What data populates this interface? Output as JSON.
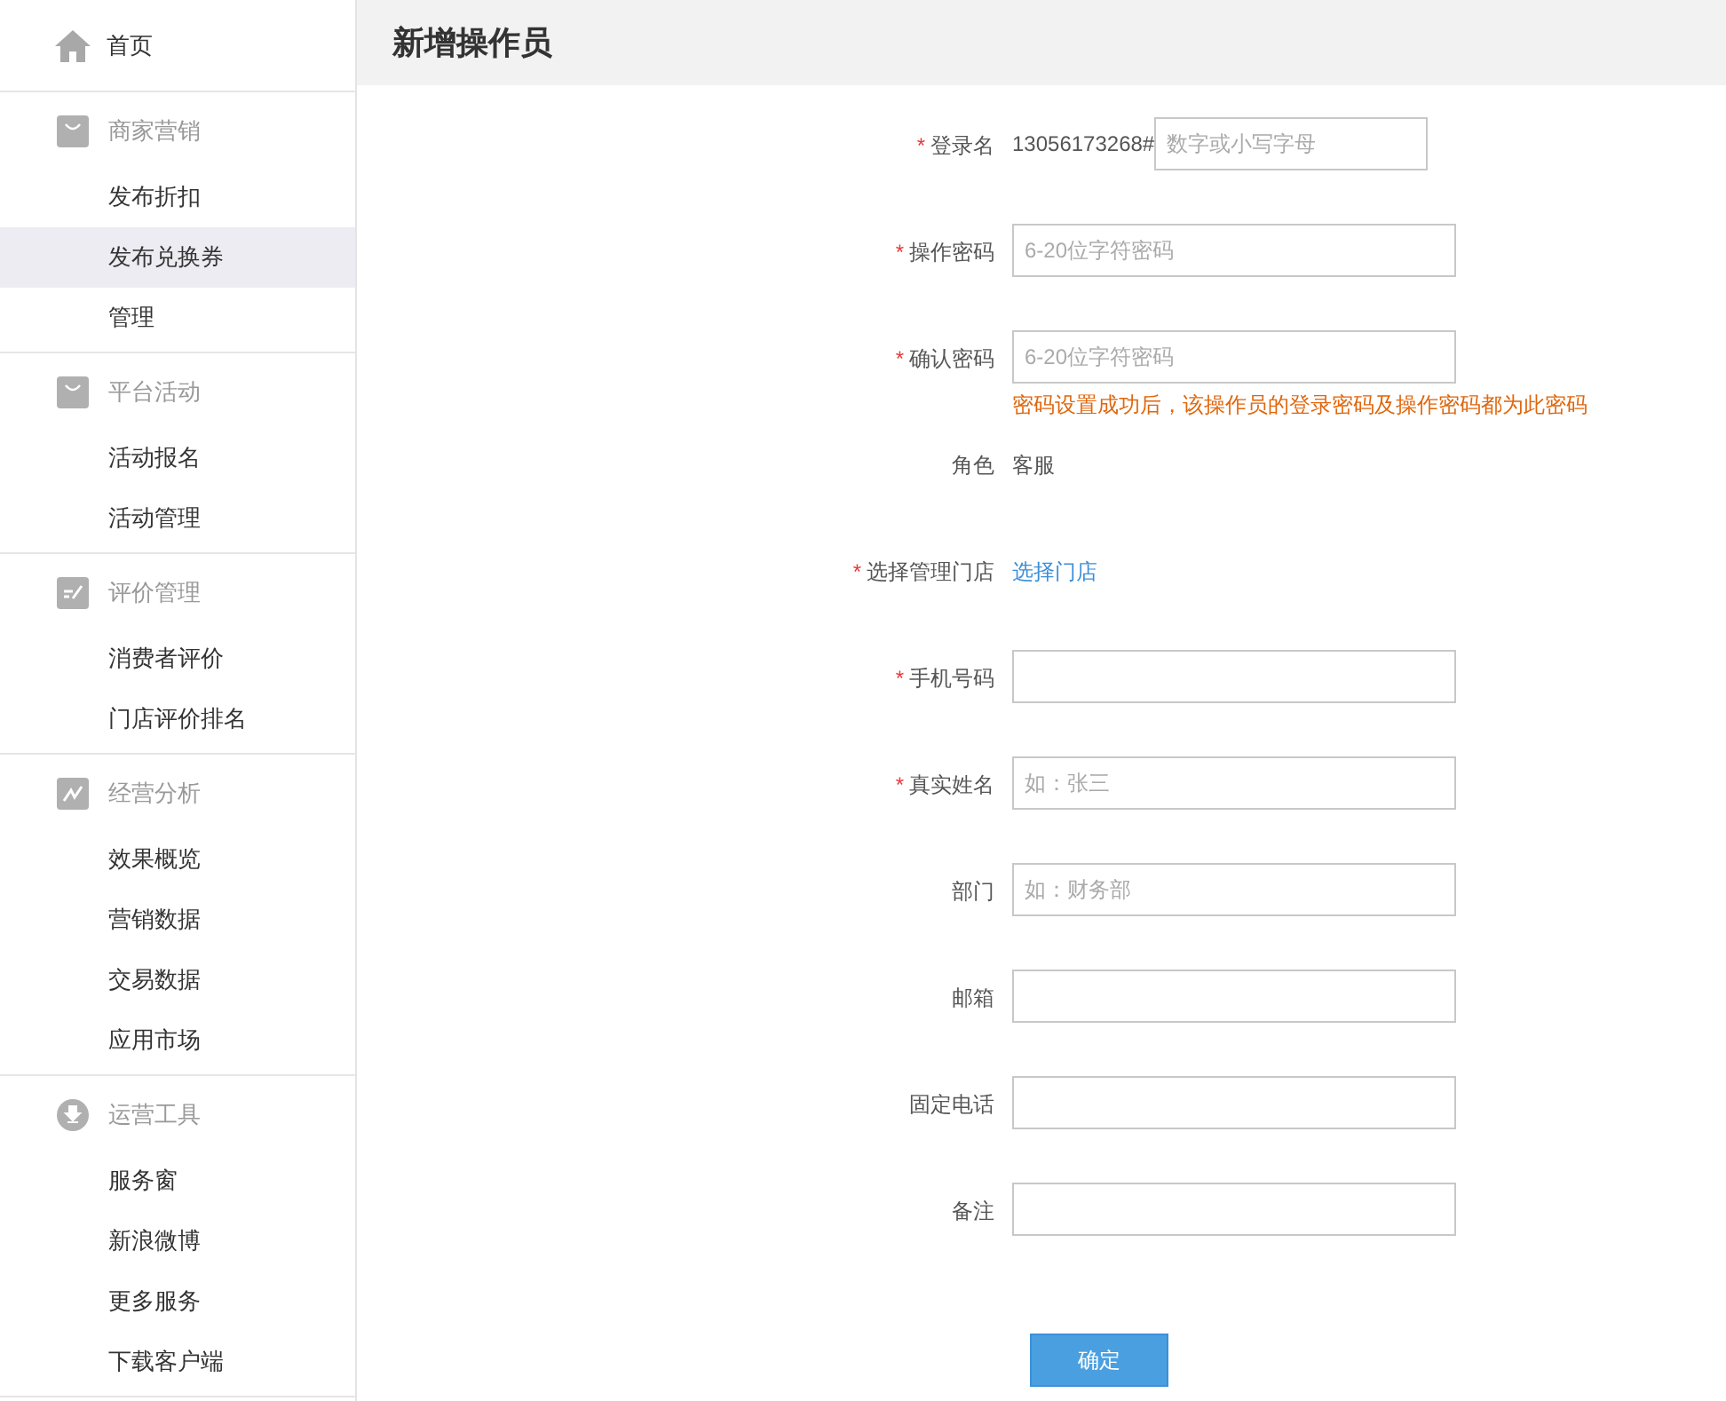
{
  "sidebar": {
    "home": {
      "label": "首页",
      "selected": false
    },
    "groups": [
      {
        "title": "商家营销",
        "items": [
          {
            "label": "发布折扣",
            "selected": false
          },
          {
            "label": "发布兑换券",
            "selected": true
          },
          {
            "label": "管理",
            "selected": false
          }
        ]
      },
      {
        "title": "平台活动",
        "items": [
          {
            "label": "活动报名",
            "selected": false
          },
          {
            "label": "活动管理",
            "selected": false
          }
        ]
      },
      {
        "title": "评价管理",
        "items": [
          {
            "label": "消费者评价",
            "selected": false
          },
          {
            "label": "门店评价排名",
            "selected": false
          }
        ]
      },
      {
        "title": "经营分析",
        "items": [
          {
            "label": "效果概览",
            "selected": false
          },
          {
            "label": "营销数据",
            "selected": false
          },
          {
            "label": "交易数据",
            "selected": false
          },
          {
            "label": "应用市场",
            "selected": false
          }
        ]
      },
      {
        "title": "运营工具",
        "items": [
          {
            "label": "服务窗",
            "selected": false
          },
          {
            "label": "新浪微博",
            "selected": false
          },
          {
            "label": "更多服务",
            "selected": false
          },
          {
            "label": "下载客户端",
            "selected": false
          }
        ]
      }
    ]
  },
  "page_title": "新增操作员",
  "form": {
    "rows": [
      {
        "kind": "prefixed_input",
        "required_mark": "*",
        "label": "登录名",
        "prefix": "13056173268#",
        "placeholder": "数字或小写字母"
      },
      {
        "kind": "input",
        "required_mark": "*",
        "label": "操作密码",
        "placeholder": "6-20位字符密码"
      },
      {
        "kind": "input",
        "required_mark": "*",
        "label": "确认密码",
        "placeholder": "6-20位字符密码",
        "hint": "密码设置成功后，该操作员的登录密码及操作密码都为此密码"
      },
      {
        "kind": "text",
        "label": "角色",
        "value": "客服"
      },
      {
        "kind": "link",
        "required_mark": "*",
        "label": "选择管理门店",
        "value": "选择门店"
      },
      {
        "kind": "input",
        "required_mark": "*",
        "label": "手机号码"
      },
      {
        "kind": "input",
        "required_mark": "*",
        "label": "真实姓名",
        "placeholder": "如：张三"
      },
      {
        "kind": "input",
        "label": "部门",
        "placeholder": "如：财务部"
      },
      {
        "kind": "input",
        "label": "邮箱"
      },
      {
        "kind": "input",
        "label": "固定电话"
      },
      {
        "kind": "input",
        "label": "备注"
      }
    ],
    "submit": "确定"
  }
}
